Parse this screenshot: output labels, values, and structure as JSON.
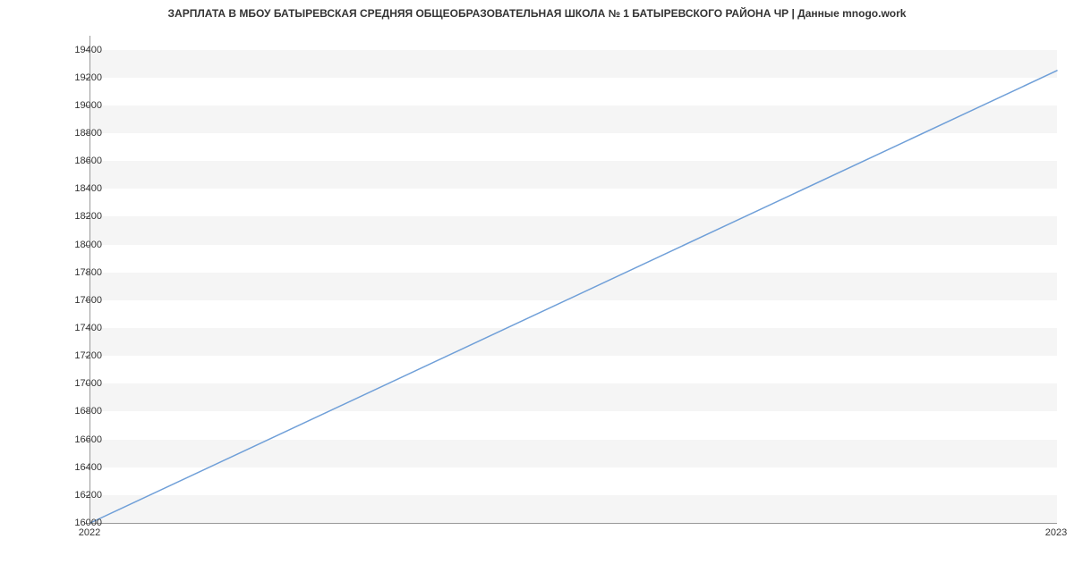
{
  "chart_data": {
    "type": "line",
    "title": "ЗАРПЛАТА В МБОУ БАТЫРЕВСКАЯ СРЕДНЯЯ ОБЩЕОБРАЗОВАТЕЛЬНАЯ ШКОЛА № 1 БАТЫРЕВСКОГО РАЙОНА ЧР | Данные mnogo.work",
    "xlabel": "",
    "ylabel": "",
    "x": [
      "2022",
      "2023"
    ],
    "values": [
      16000,
      19250
    ],
    "x_ticks": [
      "2022",
      "2023"
    ],
    "y_ticks": [
      16000,
      16200,
      16400,
      16600,
      16800,
      17000,
      17200,
      17400,
      17600,
      17800,
      18000,
      18200,
      18400,
      18600,
      18800,
      19000,
      19200,
      19400
    ],
    "ylim": [
      16000,
      19500
    ],
    "line_color": "#6f9fd8",
    "band_color": "#f5f5f5"
  }
}
